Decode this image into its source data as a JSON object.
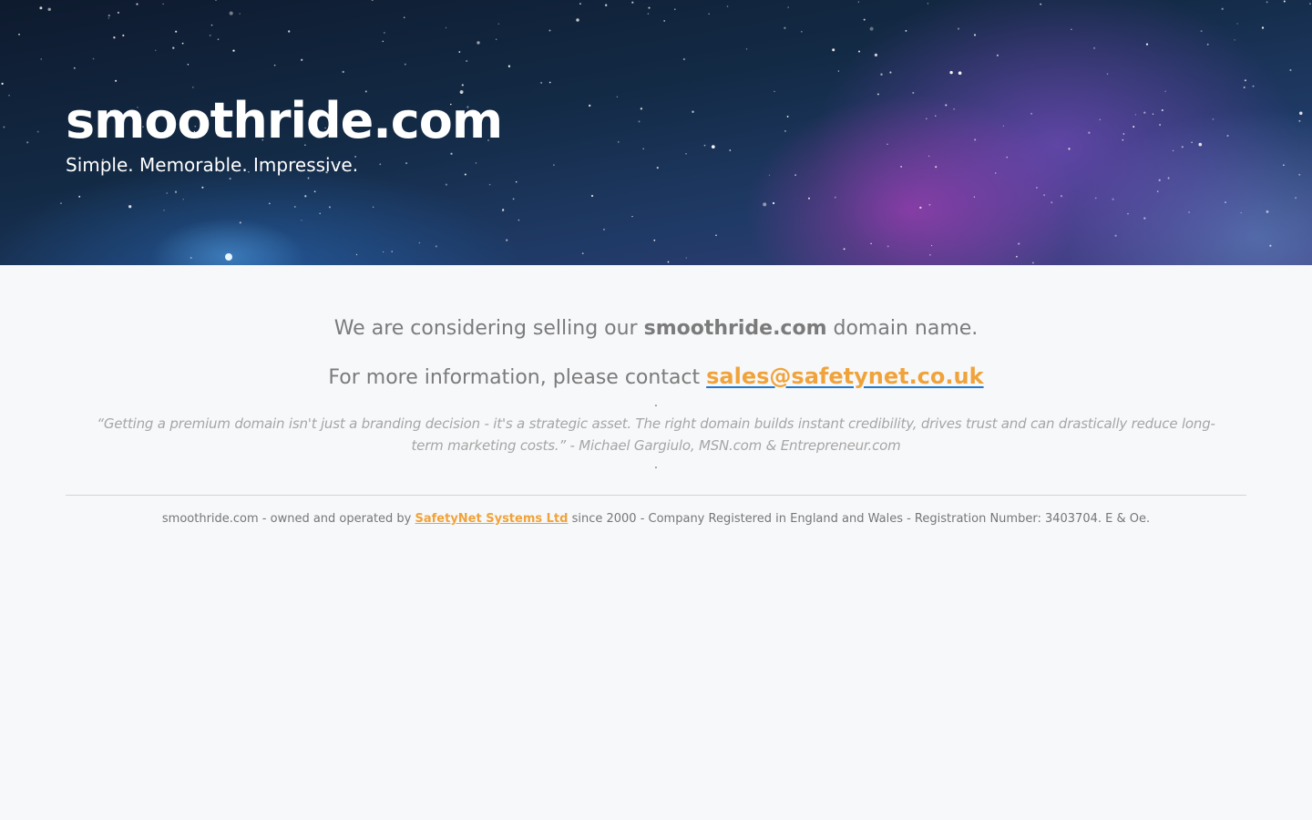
{
  "hero": {
    "title": "smoothride.com",
    "tagline": "Simple. Memorable. Impressive."
  },
  "main": {
    "offer_prefix": "We are considering selling our ",
    "offer_domain": "smoothride.com",
    "offer_suffix": " domain name.",
    "contact_prefix": "For more information, please contact ",
    "contact_email": "sales@safetynet.co.uk",
    "separator_dot": ".",
    "quote": "“Getting a premium domain isn't just a branding decision - it's a strategic asset. The right domain builds instant credibility, drives trust and can drastically reduce long-term marketing costs.” - Michael Gargiulo, MSN.com & Entrepreneur.com"
  },
  "footer": {
    "prefix": "smoothride.com - owned and operated by ",
    "company_link": "SafetyNet Systems Ltd",
    "suffix": " since 2000 - Company Registered in England and Wales - Registration Number: 3403704. E & Oe."
  },
  "colors": {
    "accent": "#f0a33a",
    "link_underline": "#1f77d0",
    "body_text": "#7b7b7b",
    "quote_text": "#a6a6a6",
    "page_background": "#f7f8fa"
  }
}
